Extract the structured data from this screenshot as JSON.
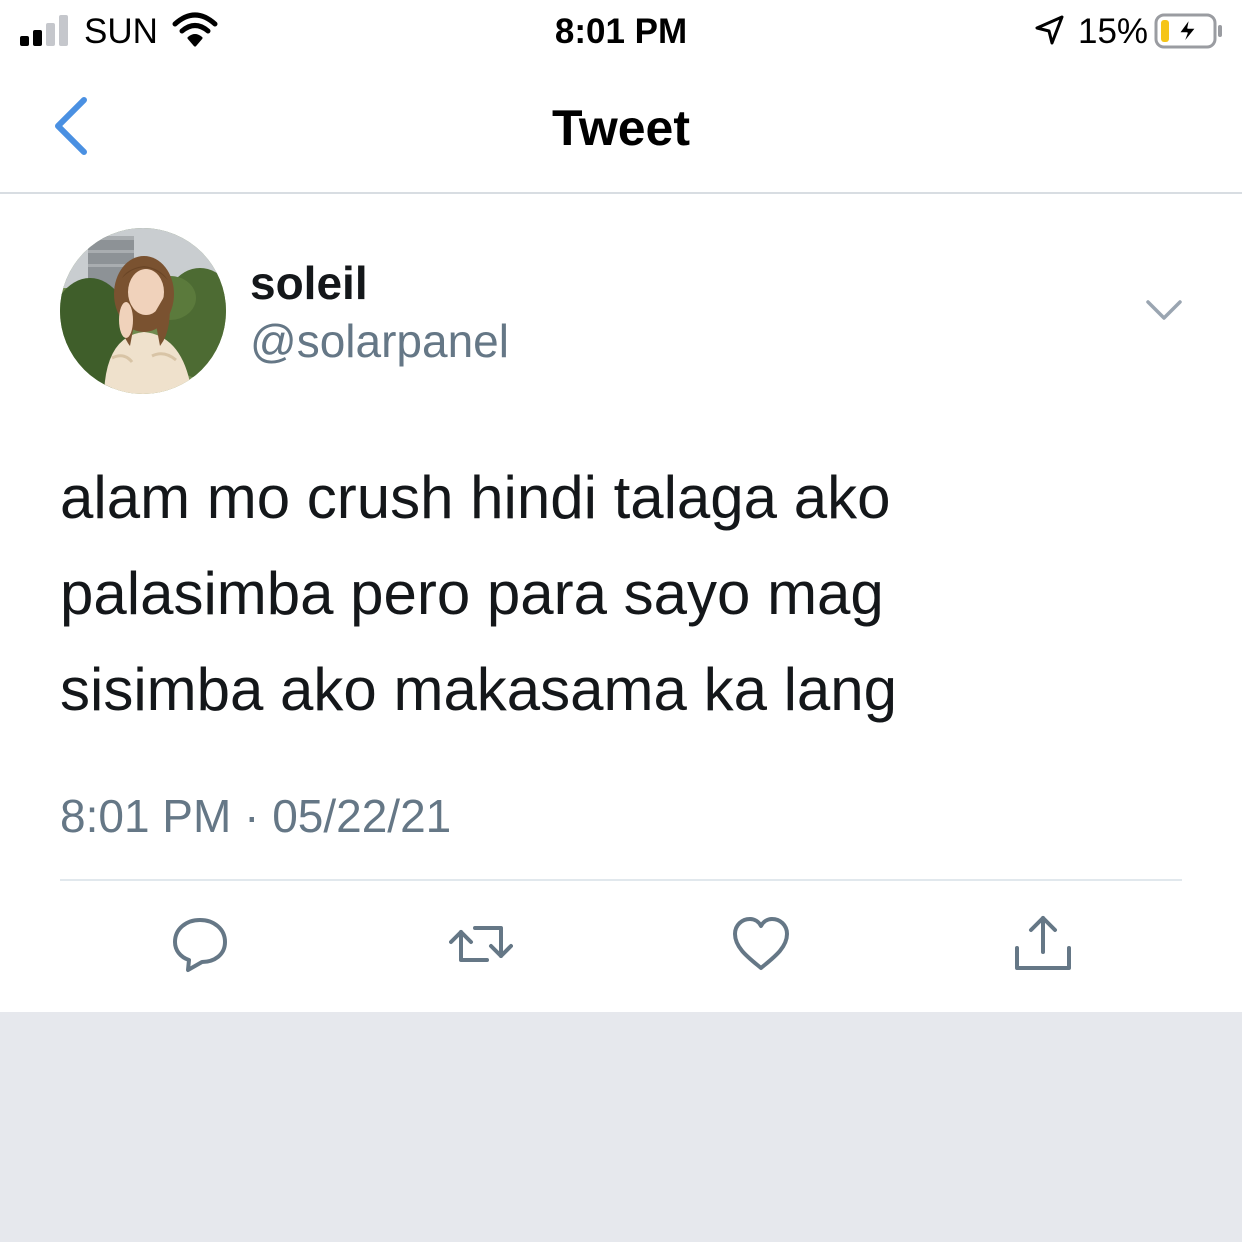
{
  "status_bar": {
    "carrier": "SUN",
    "time": "8:01 PM",
    "battery_percent": "15%",
    "signal_bars_active": 2,
    "signal_bars_total": 4,
    "icons": [
      "signal-icon",
      "wifi-icon",
      "location-arrow-icon",
      "battery-charging-icon"
    ]
  },
  "header": {
    "title": "Tweet",
    "back_icon": "chevron-left-icon"
  },
  "tweet": {
    "display_name": "soleil",
    "username": "@solarpanel",
    "text_lines": [
      "alam mo crush hindi talaga ako",
      "palasimba pero para sayo mag",
      "sisimba ako makasama ka lang"
    ],
    "timestamp": "8:01 PM · 05/22/21",
    "menu_icon": "chevron-down-icon"
  },
  "actions": [
    "reply-icon",
    "retweet-icon",
    "like-icon",
    "share-icon"
  ],
  "colors": {
    "accent": "#4a90e2",
    "text_primary": "#14171a",
    "text_secondary": "#657786",
    "icon_gray": "#657786",
    "divider": "#e1e8ed",
    "battery_low": "#f5c518",
    "background_below": "#e6e8ed"
  }
}
